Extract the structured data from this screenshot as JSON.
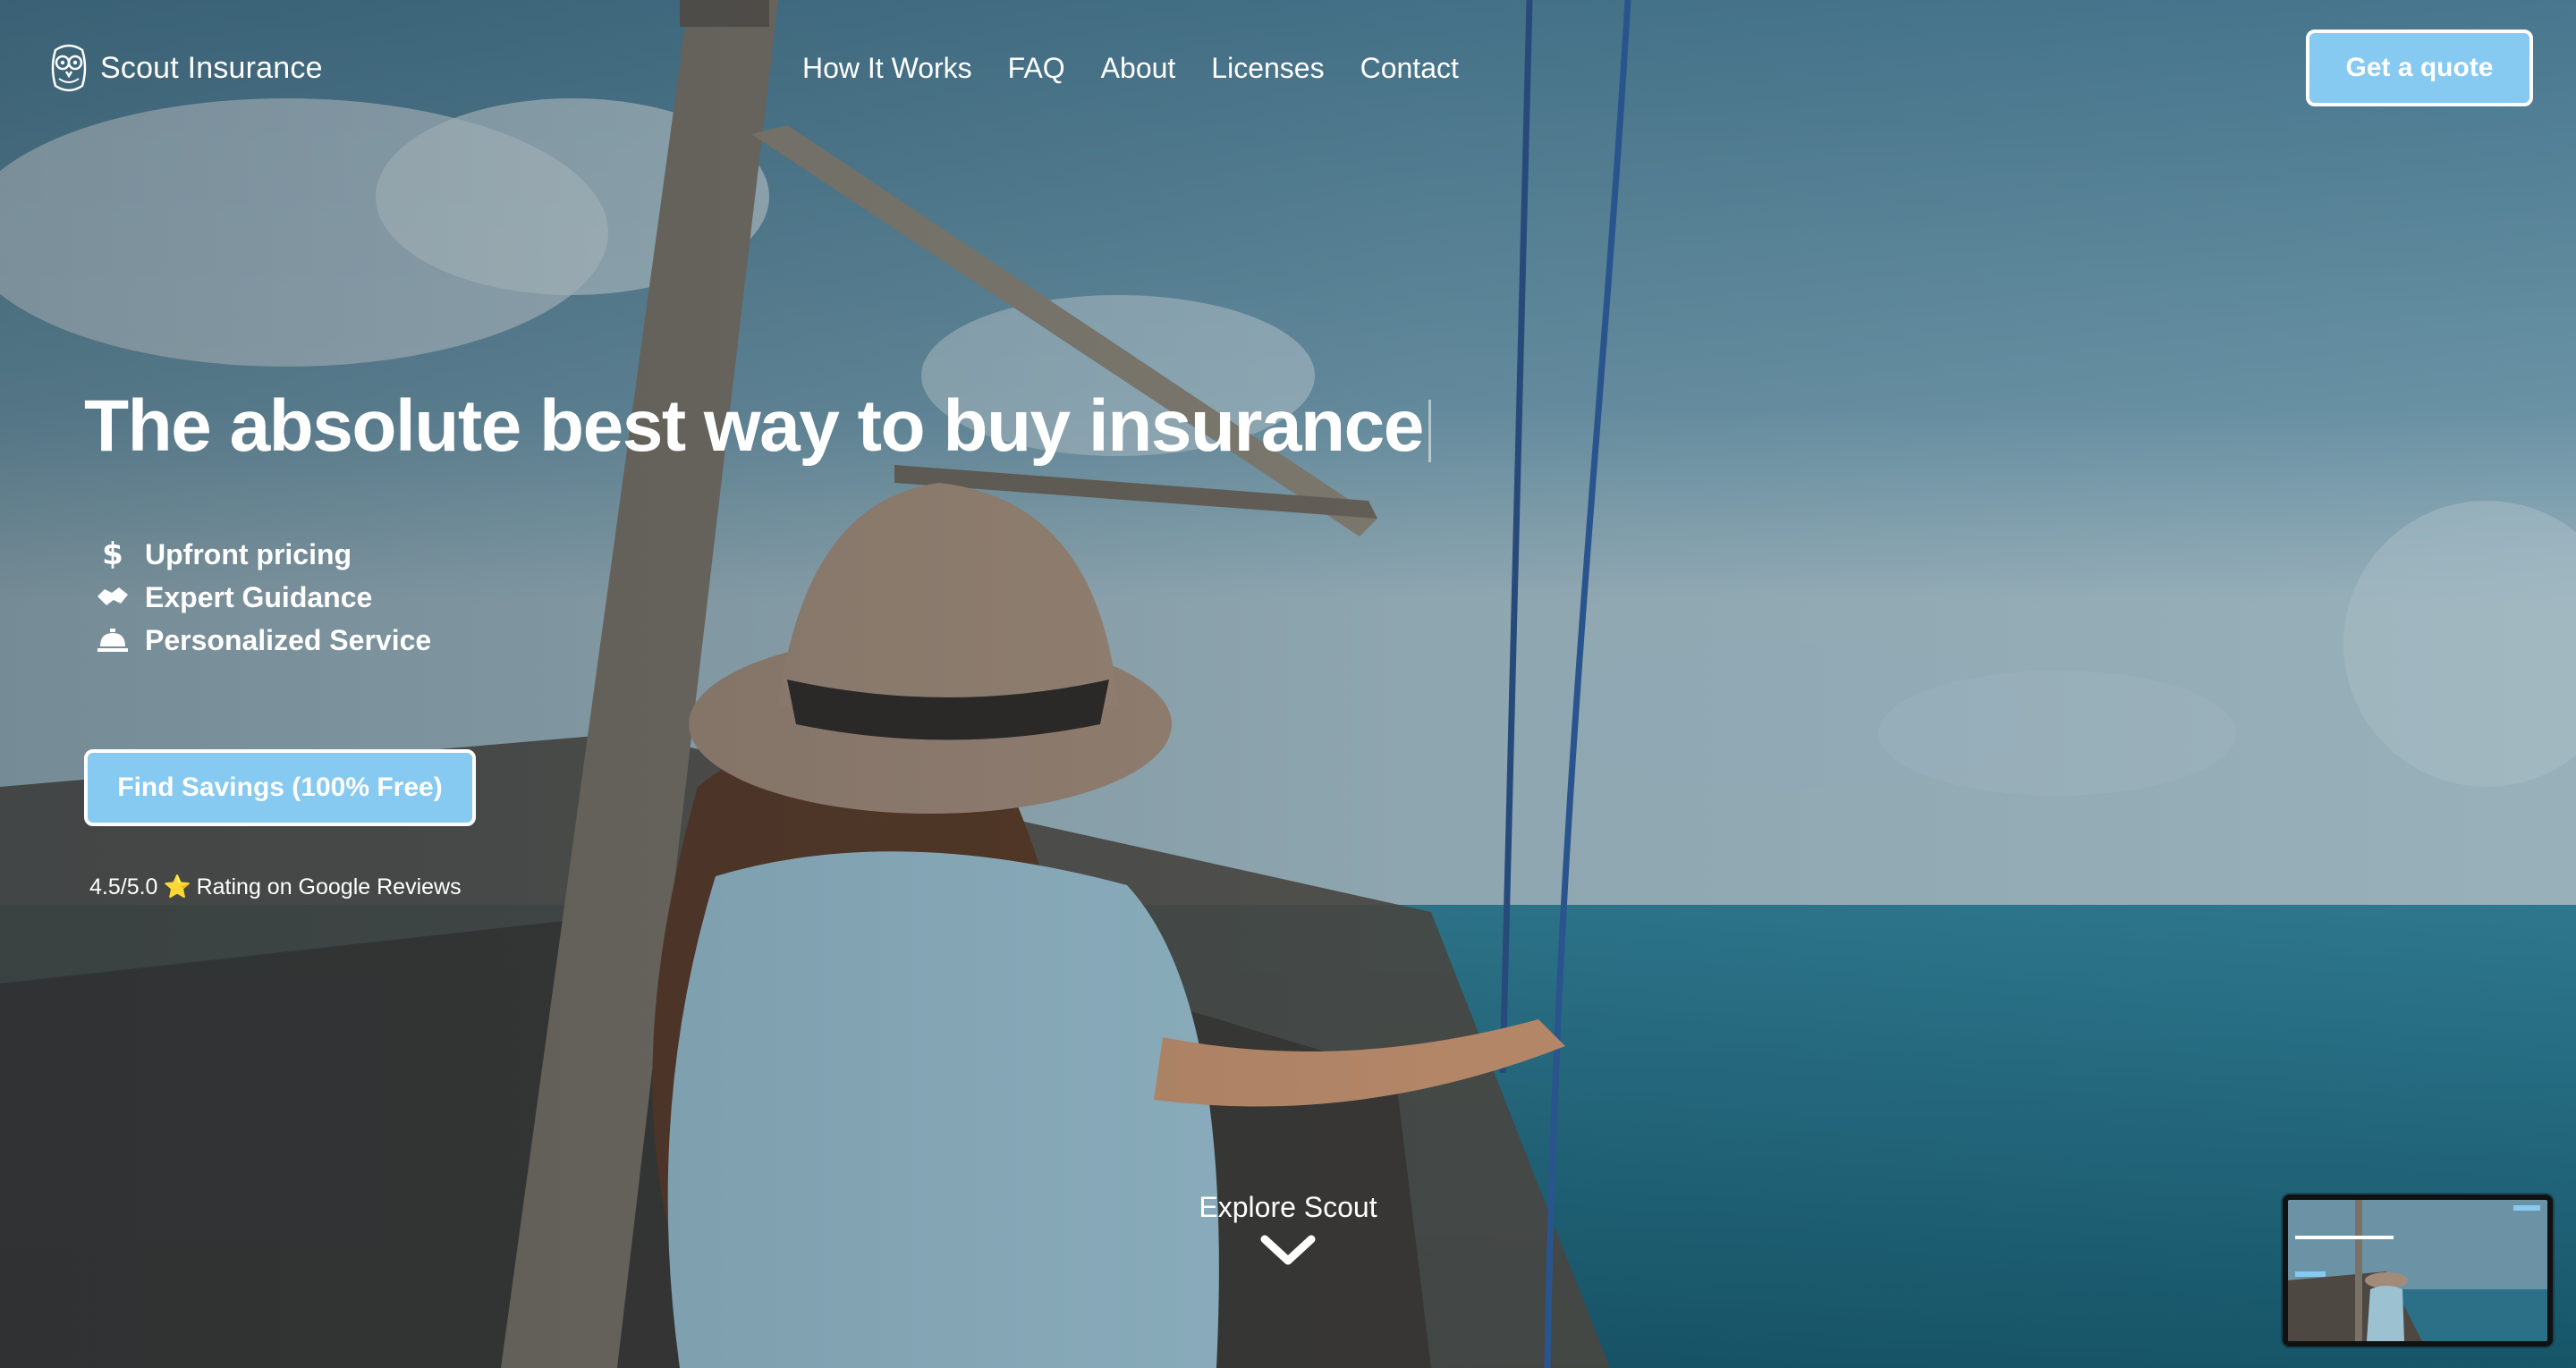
{
  "brand": {
    "name": "Scout Insurance",
    "logo_icon": "owl-icon"
  },
  "nav": {
    "items": [
      {
        "label": "How It Works"
      },
      {
        "label": "FAQ"
      },
      {
        "label": "About"
      },
      {
        "label": "Licenses"
      },
      {
        "label": "Contact"
      }
    ]
  },
  "header": {
    "cta_label": "Get a quote"
  },
  "hero": {
    "headline": "The absolute best way to buy insurance",
    "features": [
      {
        "icon": "dollar-icon",
        "label": "Upfront pricing"
      },
      {
        "icon": "handshake-icon",
        "label": "Expert Guidance"
      },
      {
        "icon": "service-bell-icon",
        "label": "Personalized Service"
      }
    ],
    "cta_label": "Find Savings (100% Free)",
    "rating_prefix": "4.5/5.0",
    "rating_star": "⭐",
    "rating_suffix": "Rating on Google Reviews",
    "explore_label": "Explore Scout"
  },
  "colors": {
    "accent": "#86c9f1",
    "text": "#ffffff",
    "star": "#f6c12f"
  }
}
